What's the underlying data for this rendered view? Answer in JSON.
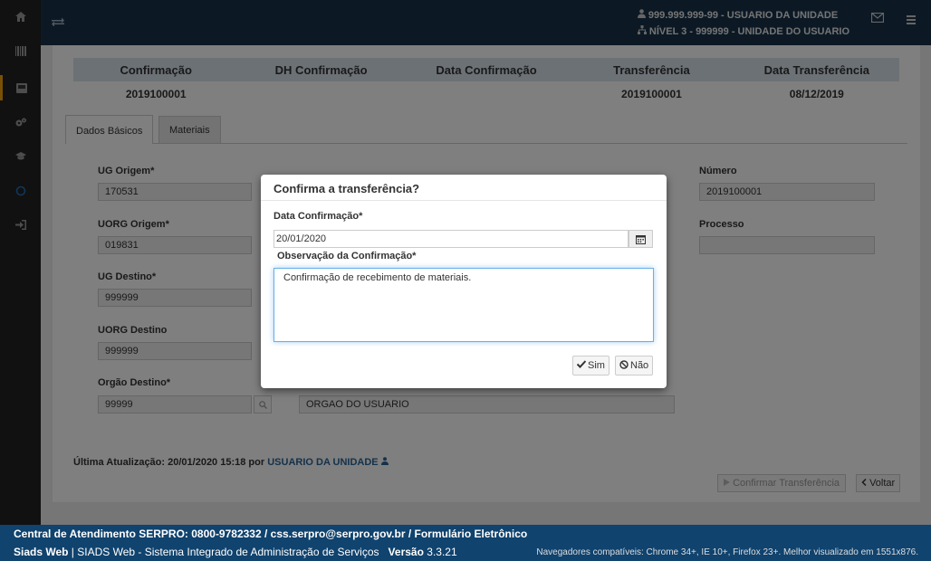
{
  "topbar": {
    "user_line": "999.999.999-99 - USUARIO DA UNIDADE",
    "level_line": "NÍVEL 3 - 999999 - UNIDADE DO USUARIO"
  },
  "summary": {
    "headers": [
      "Confirmação",
      "DH Confirmação",
      "Data Confirmação",
      "Transferência",
      "Data Transferência"
    ],
    "row": [
      "2019100001",
      "",
      "",
      "2019100001",
      "08/12/2019"
    ]
  },
  "tabs": [
    "Dados Básicos",
    "Materiais"
  ],
  "form": {
    "ug_origem_label": "UG Origem*",
    "ug_origem_value": "170531",
    "uorg_origem_label": "UORG Origem*",
    "uorg_origem_value": "019831",
    "ug_destino_label": "UG Destino*",
    "ug_destino_value": "999999",
    "uorg_destino_label": "UORG Destino",
    "uorg_destino_value": "999999",
    "orgao_destino_label": "Orgão Destino*",
    "orgao_destino_value": "99999",
    "orgao_destino_name": "ORGAO DO USUARIO",
    "numero_label": "Número",
    "numero_value": "2019100001",
    "processo_label": "Processo",
    "processo_value": ""
  },
  "last_update": {
    "label": "Última Atualização:",
    "value": "20/01/2020 15:18 por",
    "user": "USUARIO DA UNIDADE"
  },
  "actions": {
    "confirm_label": "Confirmar Transferência",
    "back_label": "Voltar"
  },
  "modal": {
    "title": "Confirma a transferência?",
    "date_label": "Data Confirmação*",
    "date_value": "20/01/2020",
    "obs_label": "Observação da Confirmação*",
    "obs_value": "Confirmação de recebimento de materiais.",
    "yes_label": "Sim",
    "no_label": "Não"
  },
  "footer": {
    "line1": "Central de Atendimento SERPRO: 0800-9782332 / css.serpro@serpro.gov.br / Formulário Eletrônico",
    "app_name": "Siads Web",
    "app_desc": " | SIADS Web - Sistema Integrado de Administração de Serviços",
    "version_label": "Versão",
    "version": "3.3.21",
    "compat": "Navegadores compatíveis: Chrome 34+, IE 10+, Firefox 23+. Melhor visualizado em 1551x876."
  }
}
